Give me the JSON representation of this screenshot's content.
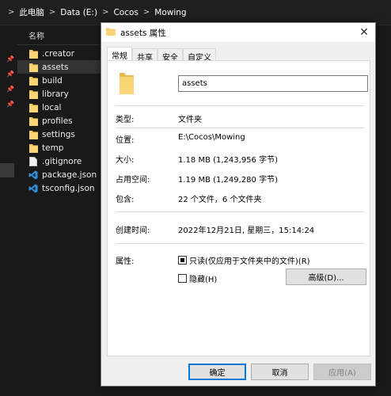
{
  "breadcrumb": [
    "此电脑",
    "Data (E:)",
    "Cocos",
    "Mowing"
  ],
  "breadcrumb_separator": ">",
  "file_list": {
    "column_header": "名称",
    "items": [
      {
        "name": ".creator",
        "icon": "folder-icon"
      },
      {
        "name": "assets",
        "icon": "folder-icon",
        "selected": true
      },
      {
        "name": "build",
        "icon": "folder-icon"
      },
      {
        "name": "library",
        "icon": "folder-icon"
      },
      {
        "name": "local",
        "icon": "folder-icon"
      },
      {
        "name": "profiles",
        "icon": "folder-icon"
      },
      {
        "name": "settings",
        "icon": "folder-icon"
      },
      {
        "name": "temp",
        "icon": "folder-icon"
      },
      {
        "name": ".gitignore",
        "icon": "file-icon"
      },
      {
        "name": "package.json",
        "icon": "vscode-icon"
      },
      {
        "name": "tsconfig.json",
        "icon": "vscode-icon"
      }
    ]
  },
  "dialog": {
    "title": "assets 属性",
    "tabs": [
      "常规",
      "共享",
      "安全",
      "自定义"
    ],
    "active_tab": "常规",
    "folder_name": "assets",
    "properties": {
      "type_label": "类型:",
      "type_value": "文件夹",
      "location_label": "位置:",
      "location_value": "E:\\Cocos\\Mowing",
      "size_label": "大小:",
      "size_value": "1.18 MB (1,243,956 字节)",
      "disk_label": "占用空间:",
      "disk_value": "1.19 MB (1,249,280 字节)",
      "contains_label": "包含:",
      "contains_value": "22 个文件，6 个文件夹",
      "created_label": "创建时间:",
      "created_value": "2022年12月21日, 星期三，15:14:24",
      "attributes_label": "属性:"
    },
    "readonly_label": "只读(仅应用于文件夹中的文件)(R)",
    "readonly_state": "indeterminate",
    "hidden_label": "隐藏(H)",
    "hidden_checked": false,
    "advanced_label": "高级(D)...",
    "ok_label": "确定",
    "cancel_label": "取消",
    "apply_label": "应用(A)",
    "close_glyph": "✕"
  },
  "colors": {
    "folder": "#f3c75f",
    "vscode": "#2f8fd8",
    "accent": "#0078d7"
  }
}
